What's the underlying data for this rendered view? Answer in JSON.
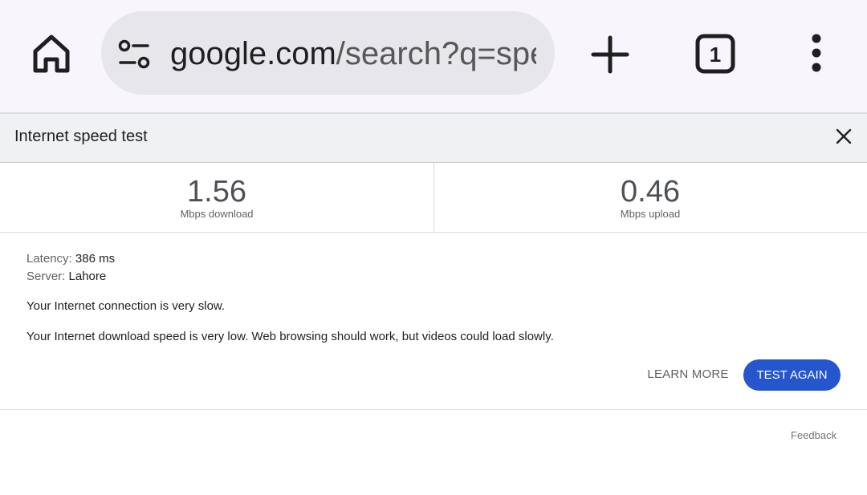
{
  "browser": {
    "url_host": "google.com",
    "url_path": "/search?q=spee",
    "tab_count": "1",
    "icons": {
      "home": "home-icon",
      "site_settings": "tune-icon",
      "new_tab": "plus-icon",
      "tabs": "tab-switcher-icon",
      "menu": "more-vert-icon"
    }
  },
  "speed_test": {
    "title": "Internet speed test",
    "download": {
      "value": "1.56",
      "unit": "Mbps download"
    },
    "upload": {
      "value": "0.46",
      "unit": "Mbps upload"
    },
    "latency": {
      "label": "Latency:",
      "value": "386 ms"
    },
    "server": {
      "label": "Server:",
      "value": "Lahore"
    },
    "summary": "Your Internet connection is very slow.",
    "detail": "Your Internet download speed is very low. Web browsing should work, but videos could load slowly.",
    "learn_more_label": "LEARN MORE",
    "test_again_label": "TEST AGAIN",
    "feedback_label": "Feedback"
  },
  "colors": {
    "accent": "#2556cc",
    "toolbar_bg": "#f8f5fc",
    "omnibox_bg": "#e7e6eb",
    "header_bg": "#f0f1f3"
  }
}
